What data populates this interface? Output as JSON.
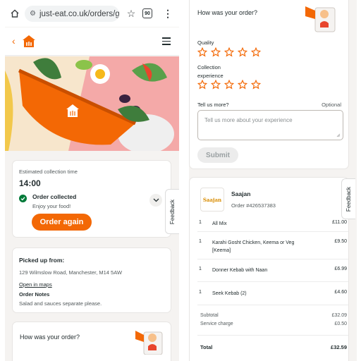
{
  "browser": {
    "url": "just-eat.co.uk/orders/g",
    "tab_count": "90"
  },
  "status": {
    "estimated_label": "Estimated collection time",
    "time": "14:00",
    "state": "Order collected",
    "sub": "Enjoy your food!",
    "order_again": "Order again"
  },
  "feedback_tab": "Feedback",
  "pickup": {
    "title": "Picked up from:",
    "address": "129 Wilmslow Road, Manchester, M14 5AW",
    "open_maps": "Open in maps",
    "notes_title": "Order Notes",
    "notes": "Salad and sauces separate please."
  },
  "review": {
    "title": "How was your order?",
    "quality_label": "Quality",
    "collection_label_1": "Collection",
    "collection_label_2": "experience",
    "tell_label": "Tell us more?",
    "optional": "Optional",
    "placeholder": "Tell us more about your experience",
    "submit": "Submit"
  },
  "restaurant": {
    "logo_text": "Saajan",
    "name": "Saajan",
    "order_number": "Order #426537383"
  },
  "items": [
    {
      "qty": "1",
      "name": "All Mix",
      "price": "£11.00"
    },
    {
      "qty": "1",
      "name": "Karahi Gosht Chicken, Keema or Veg [Keema]",
      "price": "£9.50"
    },
    {
      "qty": "1",
      "name": "Donner Kebab with Naan",
      "price": "£6.99"
    },
    {
      "qty": "1",
      "name": "Seek Kebab (2)",
      "price": "£4.60"
    }
  ],
  "totals": {
    "subtotal_label": "Subtotal",
    "subtotal": "£32.09",
    "service_label": "Service charge",
    "service": "£0.50",
    "total_label": "Total",
    "total": "£32.59"
  },
  "colors": {
    "brand_orange": "#f36805",
    "success_green": "#017a39",
    "background": "#f5f3f1"
  }
}
